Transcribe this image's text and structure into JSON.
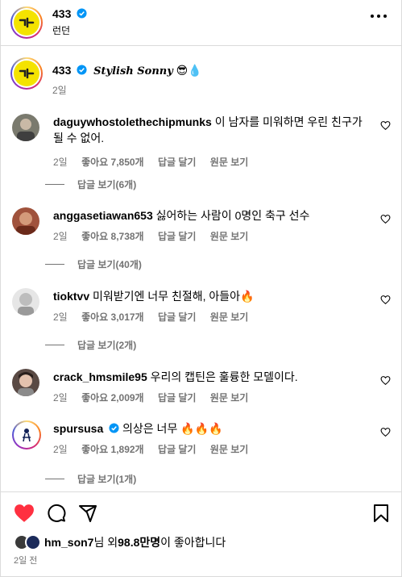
{
  "account": {
    "username": "433",
    "location": "런던",
    "verified": true
  },
  "caption": {
    "username": "433",
    "text": "Stylish Sonny",
    "emoji": "😎💧",
    "time": "2일"
  },
  "comments": [
    {
      "username": "daguywhostolethechipmunks",
      "text": "이 남자를 미워하면 우린 친구가 될 수 없어.",
      "time": "2일",
      "likes": "좋아요 7,850개",
      "reply": "답글 달기",
      "original": "원문 보기",
      "replies": "답글 보기(6개)",
      "verified": false
    },
    {
      "username": "anggasetiawan653",
      "text": "싫어하는 사람이 0명인 축구 선수",
      "time": "2일",
      "likes": "좋아요 8,738개",
      "reply": "답글 달기",
      "original": "원문 보기",
      "replies": "답글 보기(40개)",
      "verified": false
    },
    {
      "username": "tioktvv",
      "text": "미워받기엔 너무 친절해, 아들아🔥",
      "time": "2일",
      "likes": "좋아요 3,017개",
      "reply": "답글 달기",
      "original": "원문 보기",
      "replies": "답글 보기(2개)",
      "verified": false
    },
    {
      "username": "crack_hmsmile95",
      "text": "우리의 캡틴은 훌륭한 모델이다.",
      "time": "2일",
      "likes": "좋아요 2,009개",
      "reply": "답글 달기",
      "original": "원문 보기",
      "replies": "",
      "verified": false
    },
    {
      "username": "spursusa",
      "text": "의상은 너무 🔥🔥🔥",
      "time": "2일",
      "likes": "좋아요 1,892개",
      "reply": "답글 달기",
      "original": "원문 보기",
      "replies": "답글 보기(1개)",
      "verified": true
    }
  ],
  "likes_summary": {
    "user": "hm_son7",
    "suffix1": "님 외 ",
    "count": "98.8만명",
    "suffix2": "이 좋아합니다"
  },
  "post_time": "2일 전",
  "colors": {
    "like_red": "#ff3040",
    "verified_blue": "#0095f6",
    "logo_yellow": "#f4e300",
    "muted": "#737373"
  },
  "icons": [
    "more-icon",
    "heart-icon",
    "comment-icon",
    "share-icon",
    "bookmark-icon",
    "verified-icon"
  ]
}
